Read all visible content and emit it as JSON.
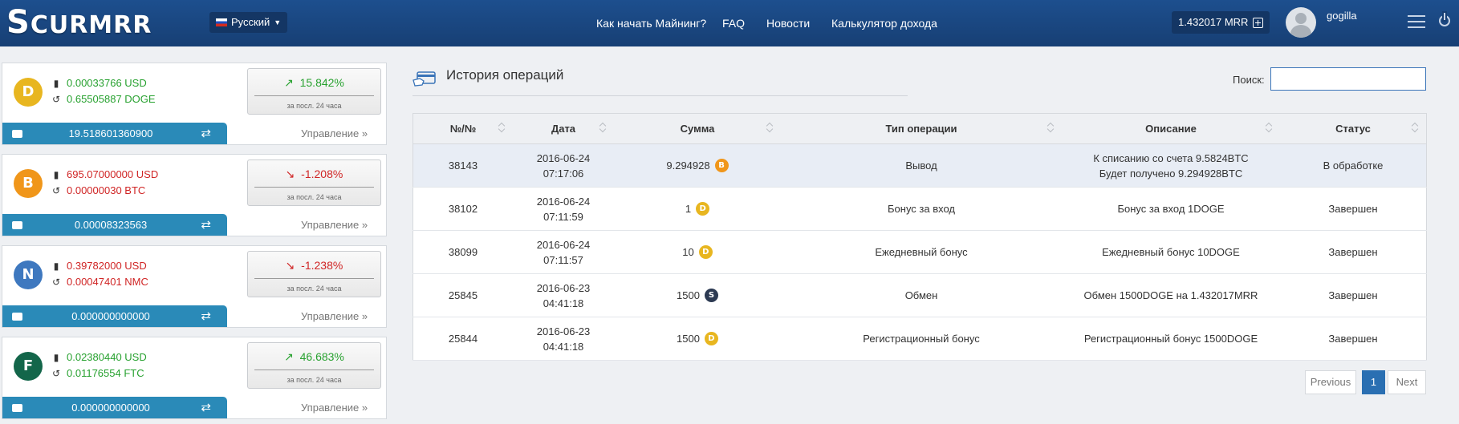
{
  "header": {
    "logo_first": "S",
    "logo_rest": "CURMRR",
    "language": "Русский",
    "nav": [
      "Как начать Майнинг?",
      "FAQ",
      "Новости",
      "Калькулятор дохода"
    ],
    "balance": "1.432017 MRR",
    "username": "gogilla"
  },
  "coins": [
    {
      "symbol": "D",
      "color": "#e8b620",
      "usd": "0.00033766 USD",
      "native": "0.65505887 DOGE",
      "trend": "up",
      "rate_color": "green",
      "change": "15.842%",
      "change_label": "за посл. 24 часа",
      "wallet": "19.518601360900",
      "manage": "Управление »"
    },
    {
      "symbol": "B",
      "color": "#f0961a",
      "usd": "695.07000000 USD",
      "native": "0.00000030 BTC",
      "trend": "down",
      "rate_color": "red",
      "change": "-1.208%",
      "change_label": "за посл. 24 часа",
      "wallet": "0.00008323563",
      "manage": "Управление »"
    },
    {
      "symbol": "N",
      "color": "#3e78bf",
      "usd": "0.39782000 USD",
      "native": "0.00047401 NMC",
      "trend": "down",
      "rate_color": "red",
      "change": "-1.238%",
      "change_label": "за посл. 24 часа",
      "wallet": "0.000000000000",
      "manage": "Управление »"
    },
    {
      "symbol": "F",
      "color": "#13664a",
      "usd": "0.02380440 USD",
      "native": "0.01176554 FTC",
      "trend": "up",
      "rate_color": "green",
      "change": "46.683%",
      "change_label": "за посл. 24 часа",
      "wallet": "0.000000000000",
      "manage": "Управление »"
    }
  ],
  "main": {
    "title": "История операций",
    "search_label": "Поиск:",
    "columns": [
      "№/№",
      "Дата",
      "Сумма",
      "Тип операции",
      "Описание",
      "Статус"
    ],
    "rows": [
      {
        "id": "38143",
        "date": "2016-06-24",
        "time": "07:17:06",
        "amount": "9.294928",
        "coin": "btc",
        "type": "Вывод",
        "desc1": "К списанию со счета 9.5824BTC",
        "desc2": "Будет получено 9.294928BTC",
        "status": "В обработке"
      },
      {
        "id": "38102",
        "date": "2016-06-24",
        "time": "07:11:59",
        "amount": "1",
        "coin": "doge",
        "type": "Бонус за вход",
        "desc1": "Бонус за вход 1DOGE",
        "desc2": "",
        "status": "Завершен"
      },
      {
        "id": "38099",
        "date": "2016-06-24",
        "time": "07:11:57",
        "amount": "10",
        "coin": "doge",
        "type": "Ежедневный бонус",
        "desc1": "Ежедневный бонус 10DOGE",
        "desc2": "",
        "status": "Завершен"
      },
      {
        "id": "25845",
        "date": "2016-06-23",
        "time": "04:41:18",
        "amount": "1500",
        "coin": "mrr",
        "type": "Обмен",
        "desc1": "Обмен 1500DOGE на 1.432017MRR",
        "desc2": "",
        "status": "Завершен"
      },
      {
        "id": "25844",
        "date": "2016-06-23",
        "time": "04:41:18",
        "amount": "1500",
        "coin": "doge",
        "type": "Регистрационный бонус",
        "desc1": "Регистрационный бонус 1500DOGE",
        "desc2": "",
        "status": "Завершен"
      }
    ],
    "pagination": {
      "prev": "Previous",
      "page": "1",
      "next": "Next"
    }
  }
}
